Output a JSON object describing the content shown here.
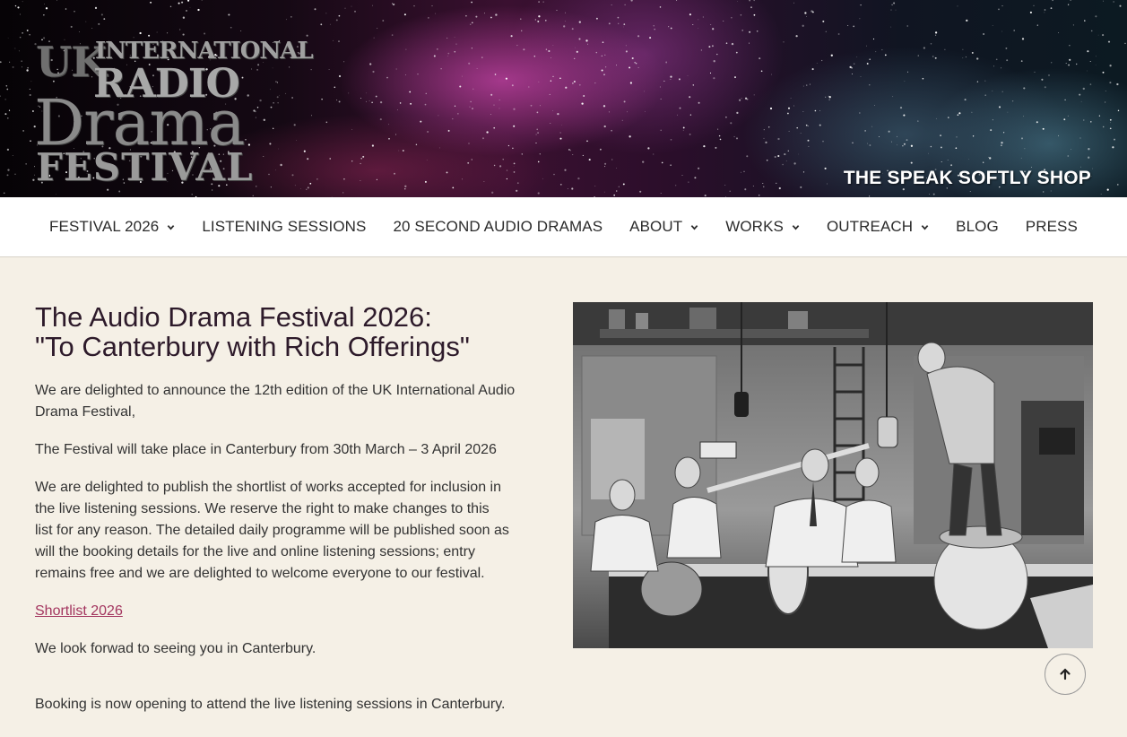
{
  "header": {
    "logo": {
      "line1_uk": "UK",
      "line1_international": "INTERNATIONAL",
      "line2": "RADIO",
      "line3": "Drama",
      "line4": "FESTIVAL"
    },
    "shop_link": "THE SPEAK SOFTLY SHOP"
  },
  "nav": {
    "items": [
      {
        "label": "FESTIVAL 2026",
        "has_dropdown": true
      },
      {
        "label": "LISTENING SESSIONS",
        "has_dropdown": false
      },
      {
        "label": "20 SECOND AUDIO DRAMAS",
        "has_dropdown": false
      },
      {
        "label": "ABOUT",
        "has_dropdown": true
      },
      {
        "label": "WORKS",
        "has_dropdown": true
      },
      {
        "label": "OUTREACH",
        "has_dropdown": true
      },
      {
        "label": "BLOG",
        "has_dropdown": false
      },
      {
        "label": "PRESS",
        "has_dropdown": false
      }
    ]
  },
  "main": {
    "title_line1": "The Audio Drama Festival 2026:",
    "title_line2": "\"To Canterbury with Rich Offerings\"",
    "para1": "We are delighted to announce the 12th edition of the UK International Audio Drama Festival,",
    "para2": "The Festival will take place in Canterbury from 30th March – 3 April 2026",
    "para3": "We are delighted to publish the shortlist of works accepted for inclusion in the live listening sessions. We reserve the right to make changes to this list for any reason. The detailed daily programme will be published soon as will the booking details for the live and online listening sessions; entry remains free and we are delighted to welcome everyone to our festival.",
    "shortlist_link": "Shortlist 2026",
    "para4": "We look forwad to seeing you in Canterbury.",
    "para5": "Booking is now opening to attend the live listening sessions in Canterbury."
  },
  "icons": {
    "dropdown": "chevron-down-icon",
    "back_to_top": "arrow-up-icon"
  },
  "colors": {
    "background": "#f5f0e6",
    "title": "#2d1a2a",
    "link": "#a3355f",
    "nav_bg": "#ffffff"
  }
}
